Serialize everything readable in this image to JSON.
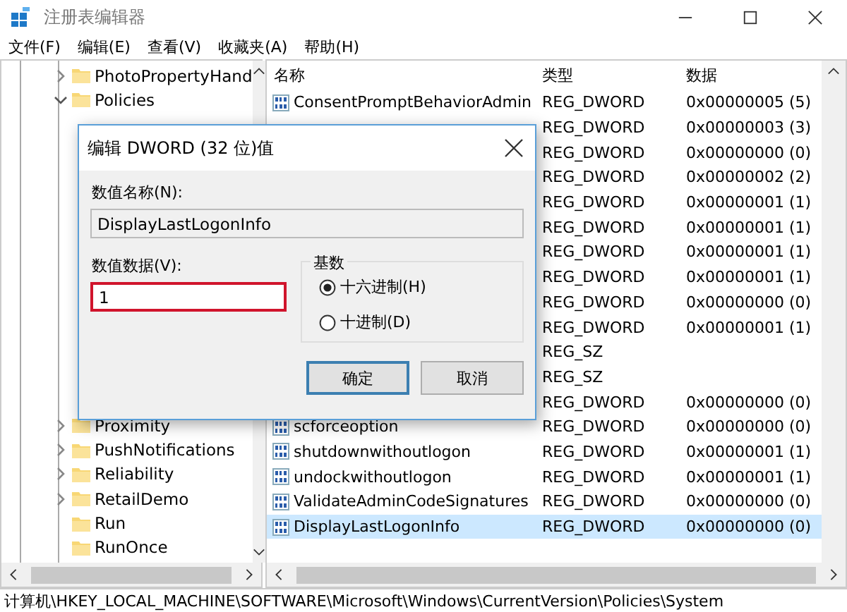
{
  "window": {
    "title": "注册表编辑器"
  },
  "menu": [
    "文件(F)",
    "编辑(E)",
    "查看(V)",
    "收藏夹(A)",
    "帮助(H)"
  ],
  "tree": {
    "upper": [
      {
        "label": "PhotoPropertyHand",
        "expanded": false
      },
      {
        "label": "Policies",
        "expanded": true
      }
    ],
    "lower": [
      {
        "label": "Proximity",
        "expanded": false
      },
      {
        "label": "PushNotifications",
        "expanded": false
      },
      {
        "label": "Reliability",
        "expanded": false
      },
      {
        "label": "RetailDemo",
        "expanded": false
      },
      {
        "label": "Run"
      },
      {
        "label": "RunOnce"
      }
    ]
  },
  "table": {
    "columns": [
      "名称",
      "类型",
      "数据"
    ],
    "rows": [
      {
        "name": "ConsentPromptBehaviorAdmin",
        "type": "REG_DWORD",
        "data": "0x00000005 (5)",
        "selected": false
      },
      {
        "type": "REG_DWORD",
        "data": "0x00000003 (3)",
        "selected": false
      },
      {
        "type": "REG_DWORD",
        "data": "0x00000000 (0)",
        "selected": false
      },
      {
        "type": "REG_DWORD",
        "data": "0x00000002 (2)",
        "selected": false
      },
      {
        "type": "REG_DWORD",
        "data": "0x00000001 (1)",
        "selected": false
      },
      {
        "type": "REG_DWORD",
        "data": "0x00000001 (1)",
        "selected": false
      },
      {
        "type": "REG_DWORD",
        "data": "0x00000001 (1)",
        "selected": false
      },
      {
        "type": "REG_DWORD",
        "data": "0x00000001 (1)",
        "selected": false
      },
      {
        "type": "REG_DWORD",
        "data": "0x00000000 (0)",
        "selected": false
      },
      {
        "type": "REG_DWORD",
        "data": "0x00000001 (1)",
        "selected": false
      },
      {
        "type": "REG_SZ",
        "selected": false
      },
      {
        "type": "REG_SZ",
        "selected": false
      },
      {
        "type": "REG_DWORD",
        "data": "0x00000000 (0)",
        "selected": false
      },
      {
        "name": "scforceoption",
        "type": "REG_DWORD",
        "data": "0x00000000 (0)",
        "selected": false
      },
      {
        "name": "shutdownwithoutlogon",
        "type": "REG_DWORD",
        "data": "0x00000001 (1)",
        "selected": false
      },
      {
        "name": "undockwithoutlogon",
        "type": "REG_DWORD",
        "data": "0x00000001 (1)",
        "selected": false
      },
      {
        "name": "ValidateAdminCodeSignatures",
        "type": "REG_DWORD",
        "data": "0x00000000 (0)",
        "selected": false
      },
      {
        "name": "DisplayLastLogonInfo",
        "type": "REG_DWORD",
        "data": "0x00000000 (0)",
        "selected": true
      }
    ]
  },
  "dialog": {
    "title": "编辑 DWORD (32 位)值",
    "name_label": "数值名称(N):",
    "name_value": "DisplayLastLogonInfo",
    "data_label": "数值数据(V):",
    "data_value": "1",
    "base_label": "基数",
    "bases": [
      {
        "label": "十六进制(H)",
        "selected": true
      },
      {
        "label": "十进制(D)",
        "selected": false
      }
    ],
    "buttons": [
      {
        "label": "确定",
        "default": true
      },
      {
        "label": "取消",
        "default": false
      }
    ]
  },
  "status_bar": "计算机\\HKEY_LOCAL_MACHINE\\SOFTWARE\\Microsoft\\Windows\\CurrentVersion\\Policies\\System"
}
